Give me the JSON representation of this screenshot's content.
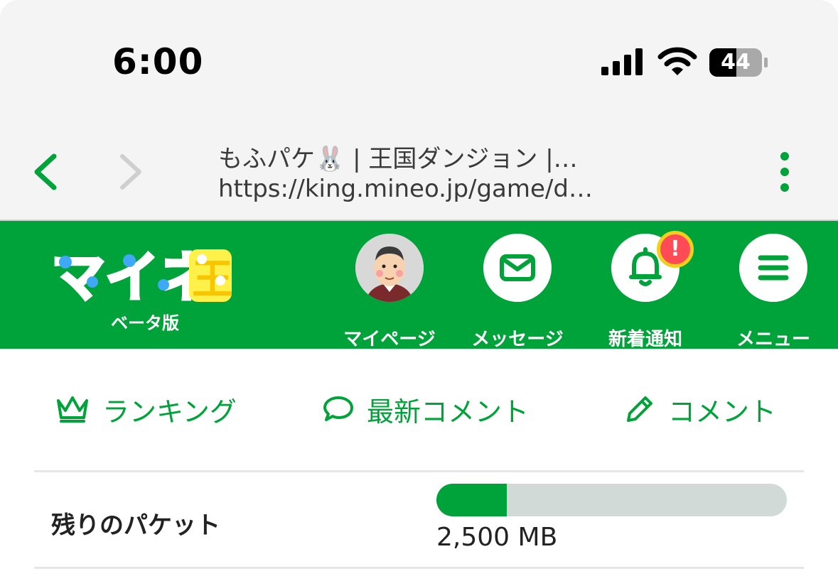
{
  "status_bar": {
    "time": "6:00",
    "battery_level": "44"
  },
  "browser": {
    "page_title": "もふパケ🐰 | 王国ダンジョン |…",
    "url": "https://king.mineo.jp/game/d…"
  },
  "header": {
    "logo_text": "マイネ王",
    "logo_sub": "ベータ版",
    "nav": [
      {
        "label": "マイページ",
        "icon": "avatar"
      },
      {
        "label": "メッセージ",
        "icon": "envelope-icon"
      },
      {
        "label": "新着通知",
        "icon": "bell-icon",
        "badge": "!"
      },
      {
        "label": "メニュー",
        "icon": "hamburger-icon"
      }
    ]
  },
  "quick_links": [
    {
      "label": "ランキング",
      "icon": "crown-icon"
    },
    {
      "label": "最新コメント",
      "icon": "speech-bubble-icon"
    },
    {
      "label": "コメント",
      "icon": "pencil-icon"
    }
  ],
  "packet": {
    "label": "残りのパケット",
    "value": "2,500 MB",
    "fill_fraction": 0.2
  },
  "colors": {
    "brand_green": "#00a23a",
    "badge_red": "#ff4b56",
    "badge_ring": "#f2cf1d",
    "track_gray": "#d1dad6"
  }
}
